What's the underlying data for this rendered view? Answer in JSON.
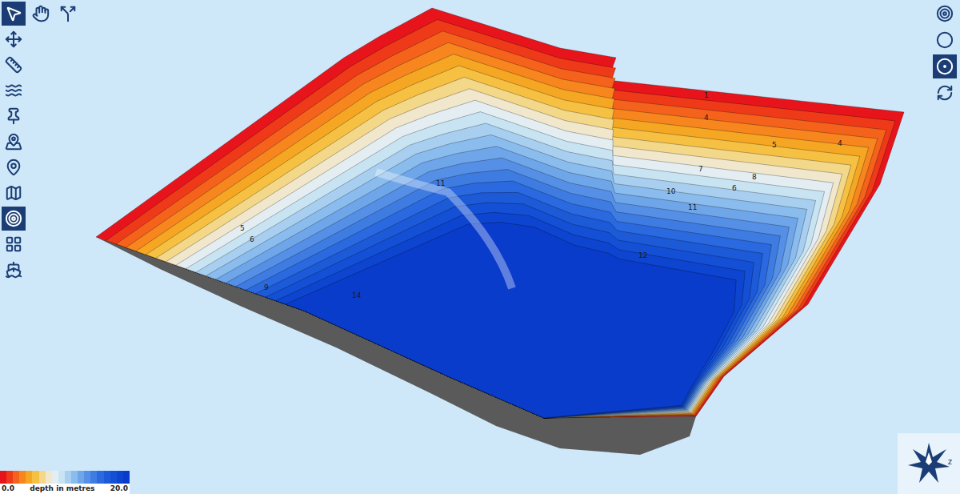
{
  "top_tools": [
    {
      "kind": "select",
      "selected": true
    },
    {
      "kind": "pan",
      "selected": false
    },
    {
      "kind": "probe",
      "selected": false
    }
  ],
  "side_tools": [
    {
      "kind": "move",
      "selected": false
    },
    {
      "kind": "scale",
      "selected": false
    },
    {
      "kind": "water",
      "selected": false
    },
    {
      "kind": "pin-lock",
      "selected": false
    },
    {
      "kind": "pin-pair",
      "selected": false
    },
    {
      "kind": "pin",
      "selected": false
    },
    {
      "kind": "outline",
      "selected": false
    },
    {
      "kind": "contours",
      "selected": true
    },
    {
      "kind": "shading",
      "selected": false
    },
    {
      "kind": "export",
      "selected": false
    }
  ],
  "view_modes": [
    {
      "kind": "rings-bold",
      "selected": false
    },
    {
      "kind": "rings-thin",
      "selected": false
    },
    {
      "kind": "rings-filled",
      "selected": true
    },
    {
      "kind": "rotate",
      "selected": false
    }
  ],
  "map": {
    "contour_labels": [
      "1",
      "4",
      "5",
      "4",
      "7",
      "8",
      "6",
      "10",
      "11",
      "5",
      "6",
      "9",
      "14",
      "12",
      "11"
    ]
  },
  "legend": {
    "min": "0.0",
    "label": "depth in metres",
    "max": "20.0",
    "colors": [
      "#e8141c",
      "#ef3a1a",
      "#f4621c",
      "#f7861f",
      "#f5a623",
      "#f6c043",
      "#f3d88a",
      "#f1e7cc",
      "#e4eef2",
      "#c8e4f3",
      "#a8cff0",
      "#8bbcee",
      "#6fa6ea",
      "#5590e6",
      "#3f7ce2",
      "#2a69df",
      "#1c5ad8",
      "#1450d6",
      "#0d45d0",
      "#0a3ccc"
    ]
  },
  "compass": {
    "label": "z"
  }
}
